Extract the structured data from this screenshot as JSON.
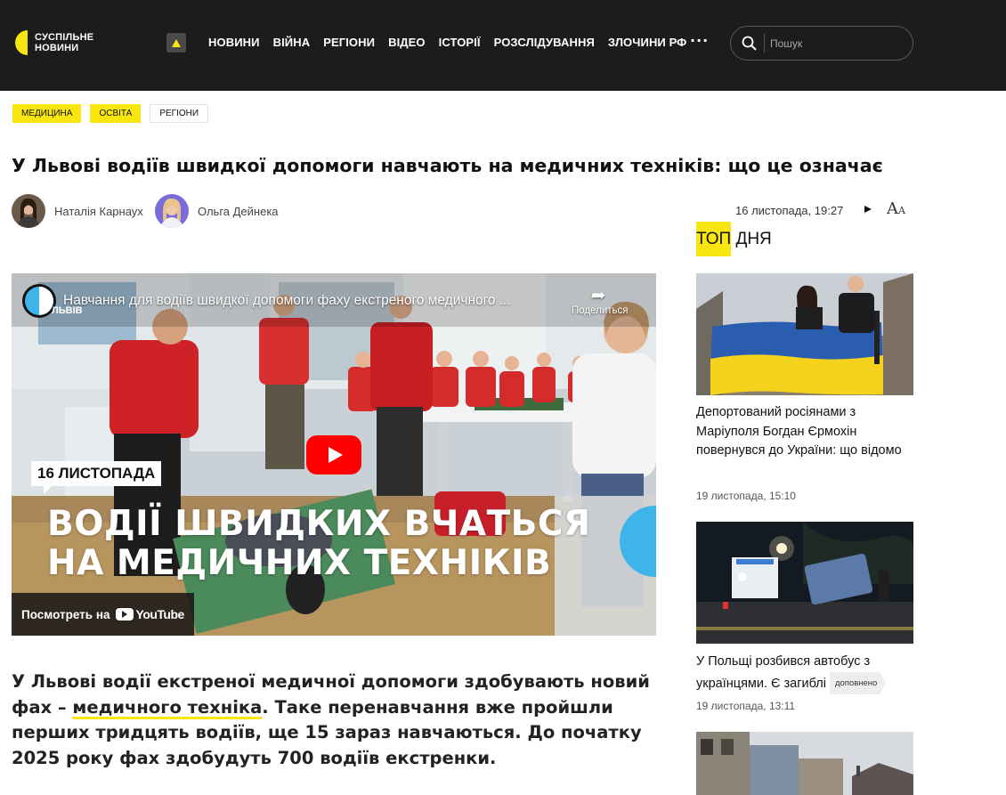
{
  "header": {
    "logo_line1": "СУСПІЛЬНЕ",
    "logo_line2": "НОВИНИ",
    "nav": [
      "НОВИНИ",
      "ВІЙНА",
      "РЕГІОНИ",
      "ВІДЕО",
      "ІСТОРІЇ",
      "РОЗСЛІДУВАННЯ",
      "ЗЛОЧИНИ РФ"
    ],
    "more": "···",
    "search_placeholder": "Пошук"
  },
  "tags": [
    "медицина",
    "освіта",
    "регіони"
  ],
  "article": {
    "title": "У Львові водіїв швидкої допомоги навчають на медичних техніків: що це означає",
    "authors": [
      "Наталія Карнаух",
      "Ольга Дейнека"
    ],
    "date": "16 листопада, 19:27",
    "lead_part1": "У Львові водії екстреної медичної допомоги здобувають новий фах – ",
    "lead_link": "медичного техніка",
    "lead_part2": ". Таке перенавчання вже пройшли перших тридцять водіїв, ще 15 зараз навчаються. До початку 2025 року фах здобудуть 700 водіїв екстренки."
  },
  "video": {
    "channel_label": "ЛЬВІВ",
    "title": "Навчання для водіїв швидкої допомоги фаху екстреного медичного ...",
    "share_label": "Поделиться",
    "date_badge": "16 ЛИСТОПАДА",
    "headline_line1": "ВОДІЇ ШВИДКИХ ВЧАТЬСЯ",
    "headline_line2": "НА МЕДИЧНИХ ТЕХНІКІВ",
    "watch_on": "Посмотреть на",
    "youtube": "YouTube"
  },
  "sidebar": {
    "title_hl": "ТОП",
    "title_rest": " ДНЯ",
    "items": [
      {
        "title": "Депортований росіянами з Маріуполя Богдан Єрмохін повернувся до України: що відомо",
        "time": "19 листопада, 15:10"
      },
      {
        "title": "У Польщі розбився автобус з українцями. Є загиблі",
        "badge": "доповнено",
        "time": "19 листопада, 13:11"
      }
    ]
  },
  "colors": {
    "accent": "#f9e50f",
    "header_bg": "#1c1c1c",
    "youtube_red": "#ff0000",
    "brand_blue": "#3fb4ea"
  }
}
